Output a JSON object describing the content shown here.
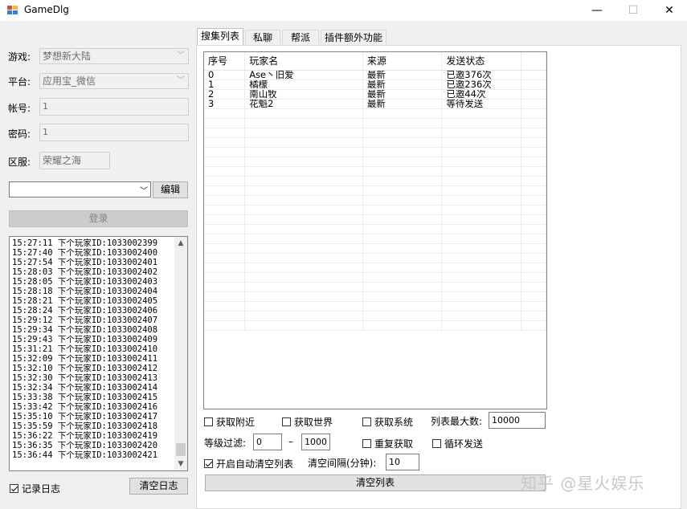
{
  "window": {
    "title": "GameDlg",
    "minimize": "—",
    "maximize": "☐",
    "close": "✕"
  },
  "left": {
    "game_label": "游戏:",
    "game_value": "梦想新大陆",
    "platform_label": "平台:",
    "platform_value": "应用宝_微信",
    "account_label": "帐号:",
    "account_value": "1",
    "password_label": "密码:",
    "password_value": "1",
    "server_label": "区服:",
    "server_value": "荣耀之海",
    "profile_value": "",
    "edit_label": "编辑",
    "login_label": "登录",
    "log_lines": [
      "15:27:11 下个玩家ID:1033002399",
      "15:27:40 下个玩家ID:1033002400",
      "15:27:54 下个玩家ID:1033002401",
      "15:28:03 下个玩家ID:1033002402",
      "15:28:05 下个玩家ID:1033002403",
      "15:28:18 下个玩家ID:1033002404",
      "15:28:21 下个玩家ID:1033002405",
      "15:28:24 下个玩家ID:1033002406",
      "15:29:12 下个玩家ID:1033002407",
      "15:29:34 下个玩家ID:1033002408",
      "15:29:43 下个玩家ID:1033002409",
      "15:31:21 下个玩家ID:1033002410",
      "15:32:09 下个玩家ID:1033002411",
      "15:32:10 下个玩家ID:1033002412",
      "15:32:30 下个玩家ID:1033002413",
      "15:32:34 下个玩家ID:1033002414",
      "15:33:38 下个玩家ID:1033002415",
      "15:33:42 下个玩家ID:1033002416",
      "15:35:10 下个玩家ID:1033002417",
      "15:35:59 下个玩家ID:1033002418",
      "15:36:22 下个玩家ID:1033002419",
      "15:36:35 下个玩家ID:1033002420",
      "15:36:44 下个玩家ID:1033002421"
    ],
    "record_log_label": "记录日志",
    "clear_log_label": "清空日志"
  },
  "tabs": [
    "搜集列表",
    "私聊",
    "帮派",
    "插件额外功能"
  ],
  "grid": {
    "columns": [
      "序号",
      "玩家名",
      "来源",
      "发送状态"
    ],
    "rows": [
      [
        "0",
        "Ase丶旧爱",
        "最新",
        "已邀376次"
      ],
      [
        "1",
        "橘檬",
        "最新",
        "已邀236次"
      ],
      [
        "2",
        "南山牧",
        "最新",
        "已邀44次"
      ],
      [
        "3",
        "花魁2",
        "最新",
        "等待发送"
      ]
    ]
  },
  "options": {
    "nearby_label": "获取附近",
    "world_label": "获取世界",
    "system_label": "获取系统",
    "max_list_label": "列表最大数:",
    "max_list_value": "10000",
    "level_filter_label": "等级过滤:",
    "level_min": "0",
    "level_sep": "–",
    "level_max": "1000",
    "repeat_fetch_label": "重复获取",
    "loop_send_label": "循环发送",
    "auto_clear_label": "开启自动清空列表",
    "interval_label": "清空间隔(分钟):",
    "interval_value": "10",
    "clear_list_label": "清空列表"
  },
  "watermark": "知乎 @星火娱乐"
}
